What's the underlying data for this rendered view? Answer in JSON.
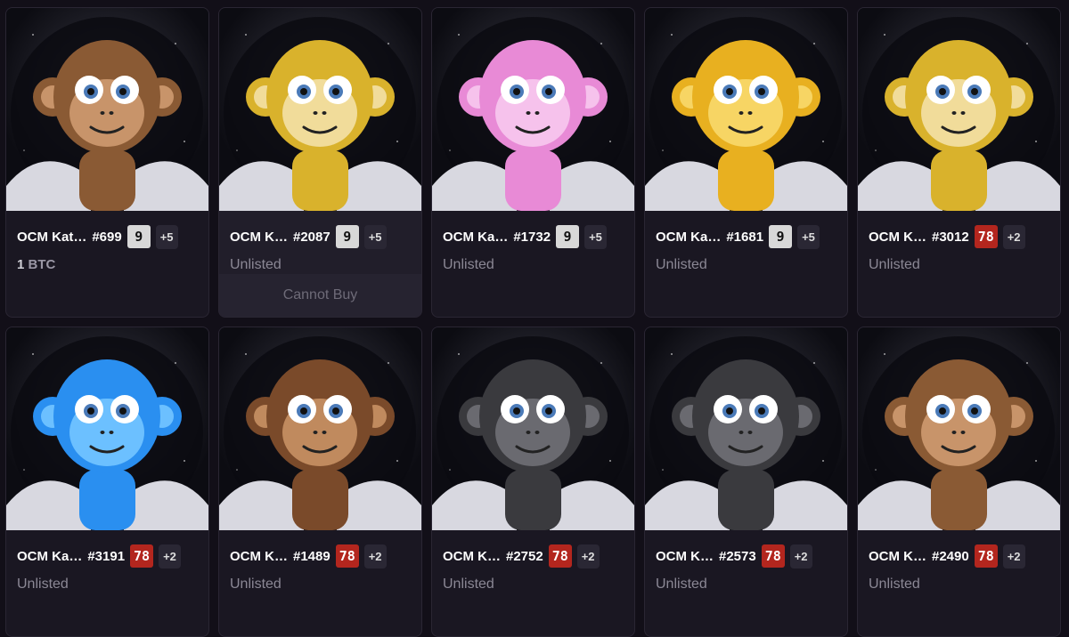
{
  "cards": [
    {
      "name": "OCM Kat…",
      "number": "#699",
      "badge": "9",
      "badge_color": "grey",
      "plus": "+5",
      "status_value": "1",
      "status_unit": "BTC",
      "listed": true,
      "fur": "#8a5a34",
      "face": "#c8946a"
    },
    {
      "name": "OCM K…",
      "number": "#2087",
      "badge": "9",
      "badge_color": "grey",
      "plus": "+5",
      "status": "Unlisted",
      "button": "Cannot Buy",
      "fur": "#d9b22c",
      "face": "#f1dc9a"
    },
    {
      "name": "OCM Ka…",
      "number": "#1732",
      "badge": "9",
      "badge_color": "grey",
      "plus": "+5",
      "status": "Unlisted",
      "fur": "#e88ad6",
      "face": "#f6c2ec"
    },
    {
      "name": "OCM Ka…",
      "number": "#1681",
      "badge": "9",
      "badge_color": "grey",
      "plus": "+5",
      "status": "Unlisted",
      "fur": "#e8b020",
      "face": "#f7d564"
    },
    {
      "name": "OCM K…",
      "number": "#3012",
      "badge": "78",
      "badge_color": "red",
      "plus": "+2",
      "status": "Unlisted",
      "fur": "#d9b22c",
      "face": "#f1dc9a"
    },
    {
      "name": "OCM Ka…",
      "number": "#3191",
      "badge": "78",
      "badge_color": "red",
      "plus": "+2",
      "status": "Unlisted",
      "fur": "#2a8ff0",
      "face": "#6cc0ff"
    },
    {
      "name": "OCM K…",
      "number": "#1489",
      "badge": "78",
      "badge_color": "red",
      "plus": "+2",
      "status": "Unlisted",
      "fur": "#7a4a2a",
      "face": "#c08a5e"
    },
    {
      "name": "OCM K…",
      "number": "#2752",
      "badge": "78",
      "badge_color": "red",
      "plus": "+2",
      "status": "Unlisted",
      "fur": "#3a3a3e",
      "face": "#6a6a70"
    },
    {
      "name": "OCM K…",
      "number": "#2573",
      "badge": "78",
      "badge_color": "red",
      "plus": "+2",
      "status": "Unlisted",
      "fur": "#3a3a3e",
      "face": "#6a6a70"
    },
    {
      "name": "OCM K…",
      "number": "#2490",
      "badge": "78",
      "badge_color": "red",
      "plus": "+2",
      "status": "Unlisted",
      "fur": "#8a5a34",
      "face": "#c8946a"
    }
  ]
}
